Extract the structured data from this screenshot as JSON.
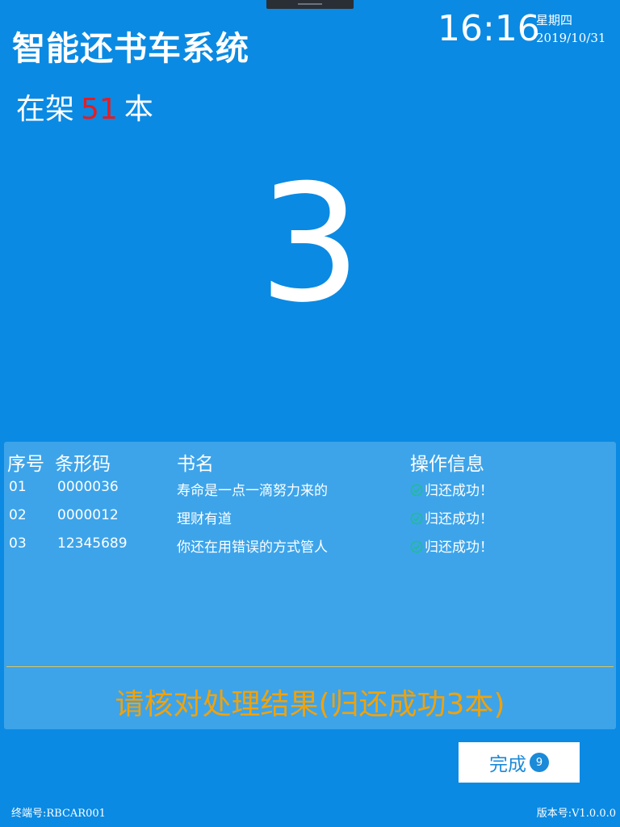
{
  "header": {
    "title": "智能还书车系统",
    "time": "16:16",
    "weekday": "星期四",
    "date": "2019/10/31"
  },
  "shelf": {
    "prefix": "在架",
    "count": "51",
    "suffix": "本"
  },
  "countdown": "3",
  "table": {
    "headers": {
      "index": "序号",
      "barcode": "条形码",
      "title": "书名",
      "status": "操作信息"
    },
    "rows": [
      {
        "index": "01",
        "barcode": "0000036",
        "title": "寿命是一点一滴努力来的",
        "status": "归还成功！"
      },
      {
        "index": "02",
        "barcode": "0000012",
        "title": "理财有道",
        "status": "归还成功！"
      },
      {
        "index": "03",
        "barcode": "12345689",
        "title": "你还在用错误的方式管人",
        "status": "归还成功！"
      }
    ]
  },
  "verify_message": "请核对处理结果(归还成功3本)",
  "done_button": {
    "label": "完成",
    "countdown": "9"
  },
  "footer": {
    "terminal": "终端号:RBCAR001",
    "version": "版本号:V1.0.0.0"
  },
  "colors": {
    "background": "#0a8ae3",
    "panel": "#3da4ea",
    "shelf_count": "#e31d24",
    "verify_message": "#f0a20c",
    "success_icon": "#19c37d",
    "button_text": "#1b8ad9"
  },
  "icons": {
    "success": "check-circle-icon"
  }
}
